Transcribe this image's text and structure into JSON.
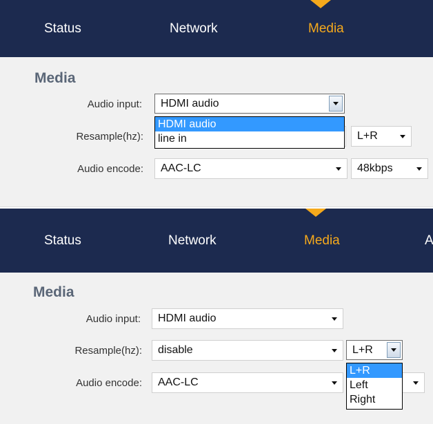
{
  "nav": {
    "tabs": [
      {
        "label": "Status"
      },
      {
        "label": "Network"
      },
      {
        "label": "Media",
        "active": true
      },
      {
        "label": "A"
      }
    ]
  },
  "colors": {
    "nav_background": "#1c2a4f",
    "active_tab": "#f5a91c",
    "highlight": "#3399ff"
  },
  "panels": [
    {
      "section_title": "Media",
      "audio_input": {
        "label": "Audio input:",
        "value": "HDMI audio",
        "open": true,
        "options": [
          "HDMI audio",
          "line in"
        ],
        "highlighted": "HDMI audio"
      },
      "resample": {
        "label": "Resample(hz):",
        "value": "",
        "channel": "L+R"
      },
      "audio_encode": {
        "label": "Audio encode:",
        "value": "AAC-LC",
        "bitrate": "48kbps"
      }
    },
    {
      "section_title": "Media",
      "audio_input": {
        "label": "Audio input:",
        "value": "HDMI audio"
      },
      "resample": {
        "label": "Resample(hz):",
        "value": "disable",
        "channel": {
          "value": "L+R",
          "open": true,
          "options": [
            "L+R",
            "Left",
            "Right"
          ],
          "highlighted": "L+R"
        }
      },
      "audio_encode": {
        "label": "Audio encode:",
        "value": "AAC-LC"
      }
    }
  ]
}
